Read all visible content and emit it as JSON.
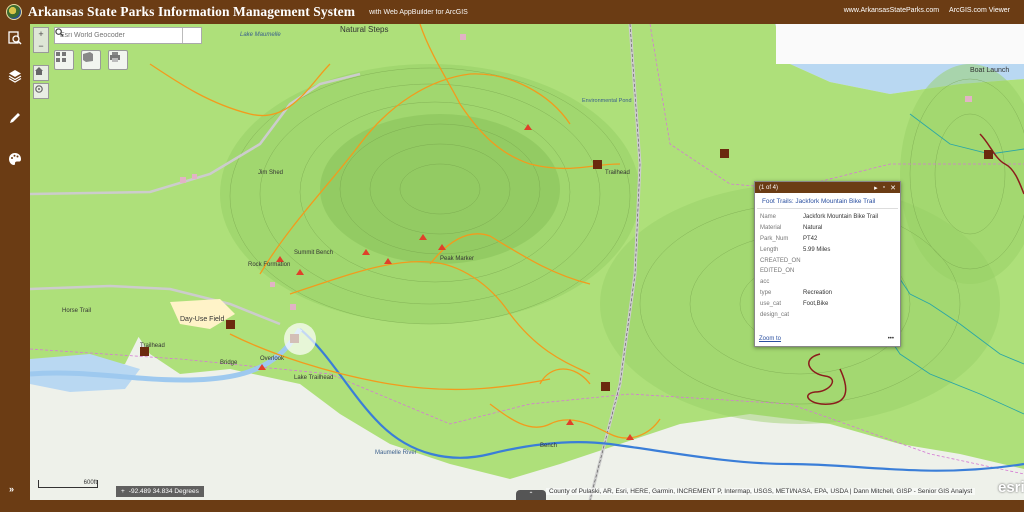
{
  "header": {
    "title": "Arkansas State Parks Information Management System",
    "subtitle": "with Web AppBuilder for ArcGIS",
    "links": [
      "www.ArkansasStateParks.com",
      "ArcGIS.com Viewer"
    ]
  },
  "search": {
    "placeholder": "Esri World Geocoder"
  },
  "popup": {
    "count": "(1 of 4)",
    "title": "Foot Trails: Jackfork Mountain Bike Trail",
    "fields": [
      {
        "key": "Name",
        "value": "Jackfork Mountain Bike Trail"
      },
      {
        "key": "Material",
        "value": "Natural"
      },
      {
        "key": "Park_Num",
        "value": "PT42"
      },
      {
        "key": "Length",
        "value": "5.99 Miles"
      },
      {
        "key": "CREATED_ON",
        "value": ""
      },
      {
        "key": "EDITED_ON",
        "value": ""
      },
      {
        "key": "acc",
        "value": ""
      },
      {
        "key": "type",
        "value": "Recreation"
      },
      {
        "key": "use_cat",
        "value": "Foot,Bike"
      },
      {
        "key": "design_cat",
        "value": ""
      }
    ],
    "zoom_label": "Zoom to",
    "more_label": "•••"
  },
  "coords": "-92.489 34.834 Degrees",
  "scale_label": "600ft",
  "attribution": "County of Pulaski, AR, Esri, HERE, Garmin, INCREMENT P, Intermap, USGS, METI/NASA, EPA, USDA | Dann Mitchell, GISP - Senior GIS Analyst",
  "esri_logo": "esri",
  "map_labels": {
    "natural_steps": "Natural Steps",
    "lake_maumelle": "Lake Maumelle",
    "trailhead": "Trailhead",
    "day_use_field": "Day-Use Field",
    "boat_launch": "Boat Launch",
    "bridge": "Bridge",
    "bench": "Bench",
    "maumelle_river": "Maumelle River",
    "rock_formation": "Rock Formation",
    "summit_bench": "Summit Bench",
    "peak_marker": "Peak Marker",
    "lake_trailhead": "Lake Trailhead",
    "environmental_pond": "Environmental Pond",
    "overlook": "Overlook",
    "jim_shed": "Jim Shed",
    "horse_trail": "Horse Trail"
  },
  "colors": {
    "chrome": "#6b3c14",
    "park_green": "#aee07a",
    "water": "#b9d8f2",
    "river": "#3a7ed8",
    "trail_orange": "#f29b1d",
    "trail_maroon": "#8b1c1c"
  },
  "icons": {
    "sidebar": [
      "query-icon",
      "layers-icon",
      "edit-icon",
      "palette-icon"
    ],
    "toolbar": [
      "grid-icon",
      "bookmark-icon",
      "print-icon"
    ]
  }
}
